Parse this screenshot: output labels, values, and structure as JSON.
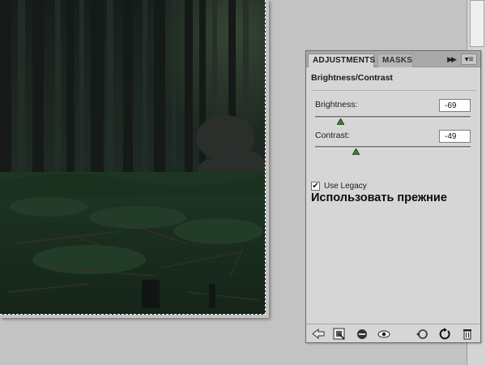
{
  "panel": {
    "tabs": [
      {
        "label": "ADJUSTMENTS",
        "active": true
      },
      {
        "label": "MASKS",
        "active": false
      }
    ],
    "title": "Brightness/Contrast",
    "brightness": {
      "label": "Brightness:",
      "value": "-69",
      "slider_fraction": 0.16
    },
    "contrast": {
      "label": "Contrast:",
      "value": "-49",
      "slider_fraction": 0.26
    },
    "use_legacy": {
      "label": "Use Legacy",
      "checked": true,
      "checkmark": "✔"
    },
    "caption_russian": "Использовать прежние",
    "icons": {
      "expand": "expand-arrows-icon",
      "menu": "panel-menu-icon",
      "bottom": [
        "back-arrow-icon",
        "expanded-view-icon",
        "clip-to-layer-icon",
        "visibility-eye-icon",
        "previous-state-icon",
        "reset-icon",
        "trash-icon"
      ]
    },
    "colors": {
      "slider_thumb": "#3a7d2c",
      "panel_bg": "#d6d6d6"
    }
  },
  "canvas": {
    "image": "dark-forest-photo"
  }
}
